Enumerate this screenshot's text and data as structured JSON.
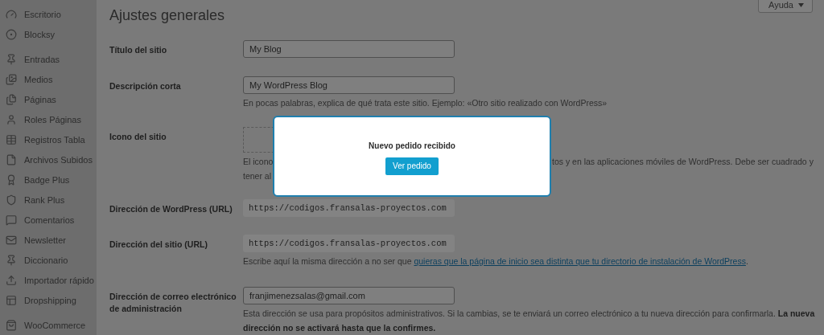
{
  "sidebar": {
    "items": [
      {
        "label": "Escritorio"
      },
      {
        "label": "Blocksy"
      },
      {
        "label": "Entradas"
      },
      {
        "label": "Medios"
      },
      {
        "label": "Páginas"
      },
      {
        "label": "Roles Páginas"
      },
      {
        "label": "Registros Tabla"
      },
      {
        "label": "Archivos Subidos"
      },
      {
        "label": "Badge Plus"
      },
      {
        "label": "Rank Plus"
      },
      {
        "label": "Comentarios"
      },
      {
        "label": "Newsletter"
      },
      {
        "label": "Diccionario"
      },
      {
        "label": "Importador rápido"
      },
      {
        "label": "Dropshipping"
      },
      {
        "label": "WooCommerce"
      }
    ]
  },
  "help_button": "Ayuda",
  "page_title": "Ajustes generales",
  "fields": [
    {
      "kind": "input",
      "label": "Título del sitio",
      "value": "My Blog"
    },
    {
      "kind": "input",
      "label": "Descripción corta",
      "value": "My WordPress Blog",
      "help": "En pocas palabras, explica de qué trata este sitio. Ejemplo: «Otro sitio realizado con WordPress»"
    },
    {
      "kind": "icon",
      "label": "Icono del sitio",
      "help_left": [
        "El icono",
        "tener al"
      ],
      "help_right": "tos y en las aplicaciones móviles de WordPress. Debe ser cuadrado y"
    },
    {
      "kind": "readonly",
      "label": "Dirección de WordPress (URL)",
      "value": "https://codigos.fransalas-proyectos.com"
    },
    {
      "kind": "readonly",
      "label": "Dirección del sitio (URL)",
      "value": "https://codigos.fransalas-proyectos.com",
      "help": "Escribe aquí la misma dirección a no ser que ",
      "help_link": "quieras que la página de inicio sea distinta que tu directorio de instalación de WordPress",
      "help_end": "."
    },
    {
      "kind": "input",
      "label": "Dirección de correo electrónico de administración",
      "value": "franjimenezsalas@gmail.com",
      "help": "Esta dirección se usa para propósitos administrativos. Si la cambias, se te enviará un correo electrónico a tu nueva dirección para confirmarla. **La nueva dirección no se activará hasta que la confirmes.**"
    }
  ],
  "modal": {
    "message": "Nuevo pedido recibido",
    "button": "Ver pedido"
  }
}
